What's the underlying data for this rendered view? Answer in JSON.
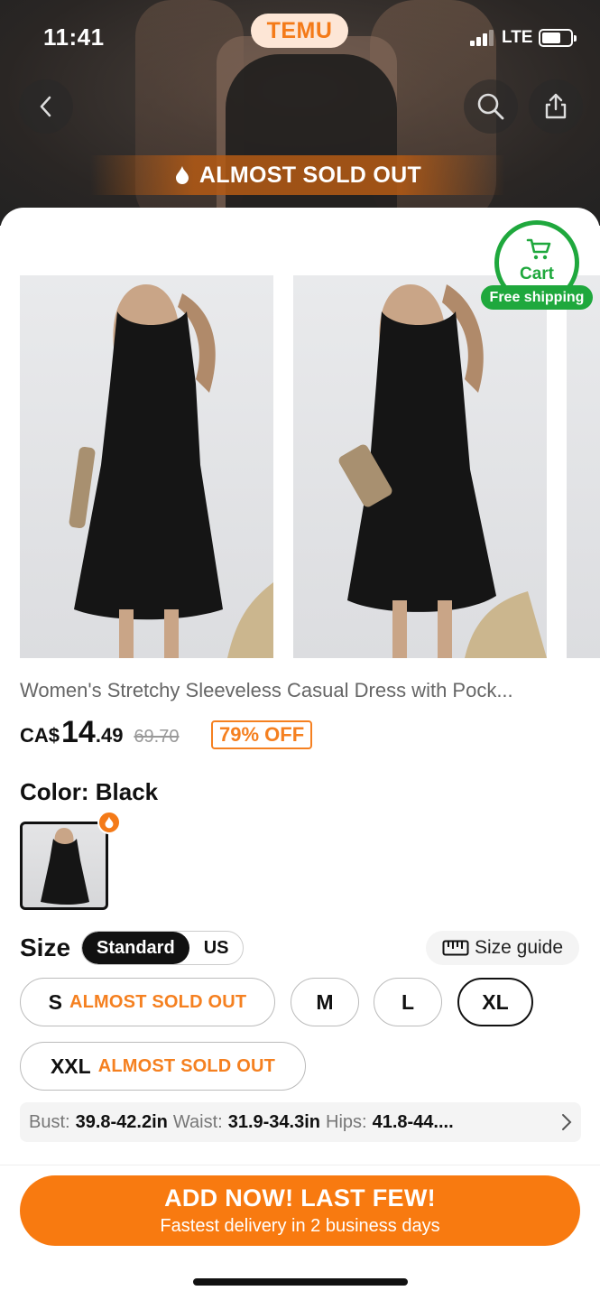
{
  "status_bar": {
    "time": "11:41",
    "brand": "TEMU",
    "network": "LTE"
  },
  "hero": {
    "banner_text": "ALMOST SOLD OUT"
  },
  "cart_badge": {
    "label": "Cart",
    "free_shipping": "Free shipping"
  },
  "product": {
    "title": "Women's Stretchy Sleeveless Casual Dress with Pock...",
    "price": {
      "currency": "CA$",
      "whole": "14",
      "cents": ".49",
      "original": "69.70",
      "discount": "79% OFF"
    },
    "color_label": "Color: Black"
  },
  "size": {
    "label": "Size",
    "systems": [
      "Standard",
      "US"
    ],
    "selected_system": "Standard",
    "guide_label": "Size guide",
    "options": [
      {
        "size": "S",
        "note": "ALMOST SOLD OUT"
      },
      {
        "size": "M",
        "note": ""
      },
      {
        "size": "L",
        "note": ""
      },
      {
        "size": "XL",
        "note": ""
      },
      {
        "size": "XXL",
        "note": "ALMOST SOLD OUT"
      }
    ],
    "selected": "XL",
    "measurements": {
      "bust_label": "Bust:",
      "bust": "39.8-42.2in",
      "waist_label": "Waist:",
      "waist": "31.9-34.3in",
      "hips_label": "Hips:",
      "hips": "41.8-44...."
    }
  },
  "cta": {
    "line1": "ADD NOW! LAST FEW!",
    "line2": "Fastest delivery in 2 business days"
  },
  "colors": {
    "accent": "#f87a10",
    "green": "#1fa83d"
  },
  "icons": [
    "back-icon",
    "search-icon",
    "share-icon",
    "flame-icon",
    "cart-icon",
    "ruler-icon",
    "chevron-right-icon"
  ]
}
